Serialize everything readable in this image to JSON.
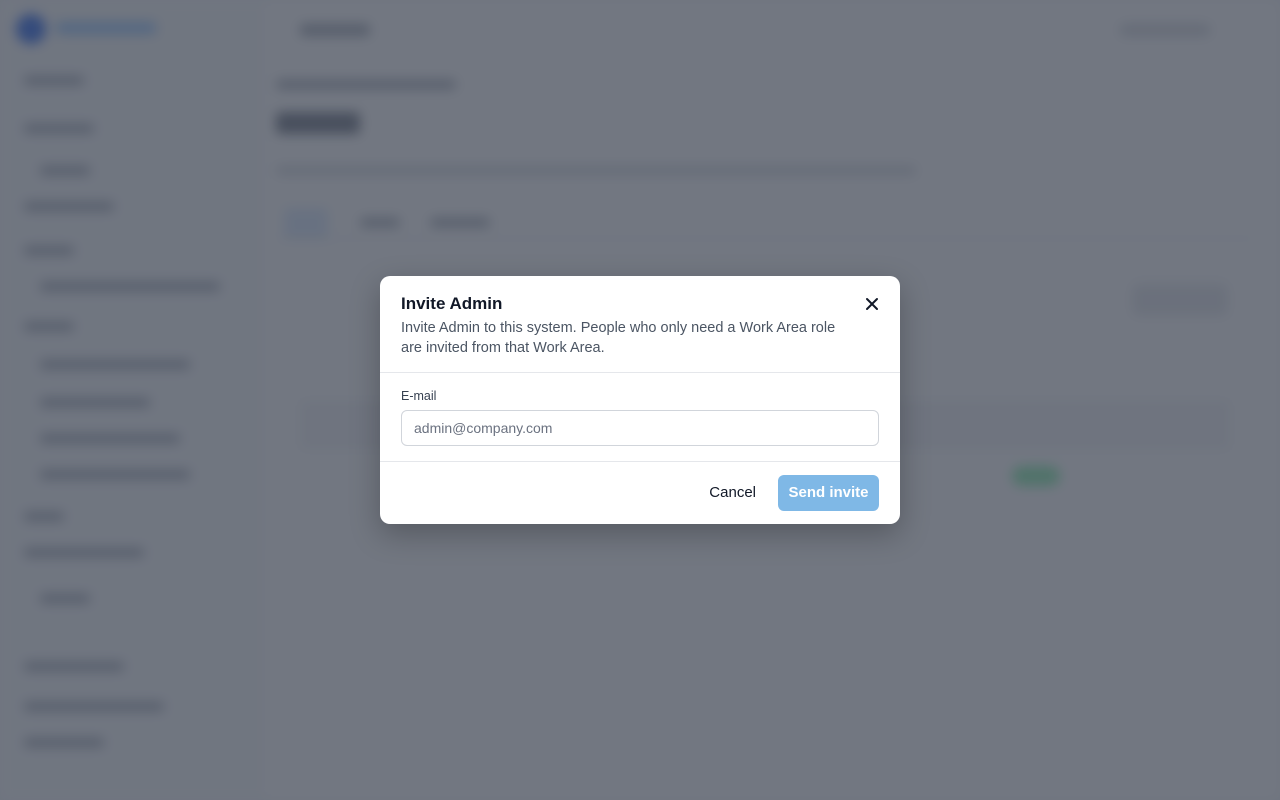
{
  "modal": {
    "title": "Invite Admin",
    "description": "Invite Admin to this system. People who only need a Work Area role are invited from that Work Area.",
    "email_label": "E-mail",
    "email_placeholder": "admin@company.com",
    "email_value": "",
    "cancel_label": "Cancel",
    "send_label": "Send invite",
    "close_icon": "close-icon"
  },
  "colors": {
    "primary_disabled": "#7fb8e6",
    "overlay": "#3c4250"
  }
}
